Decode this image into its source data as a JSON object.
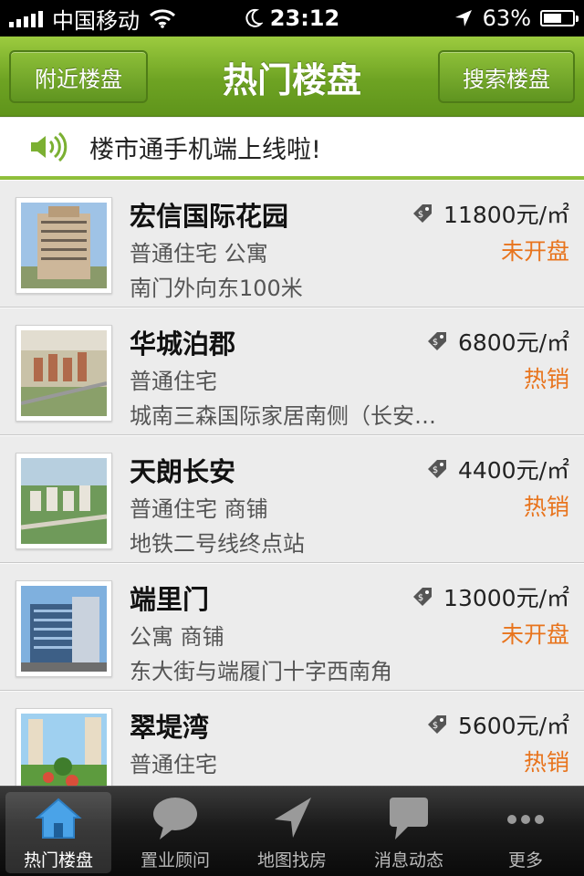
{
  "status_bar": {
    "carrier": "中国移动",
    "time": "23:12",
    "battery_percent": "63%",
    "battery_level": 0.63,
    "icons": [
      "signal-icon",
      "wifi-icon",
      "moon-icon",
      "location-arrow-icon",
      "battery-icon"
    ]
  },
  "nav": {
    "left_button": "附近楼盘",
    "title": "热门楼盘",
    "right_button": "搜索楼盘"
  },
  "notice": {
    "icon": "speaker-icon",
    "text": "楼市通手机端上线啦!"
  },
  "listings": [
    {
      "name": "宏信国际花园",
      "type": "普通住宅 公寓",
      "address": "南门外向东100米",
      "price": "11800元/㎡",
      "status": "未开盘",
      "thumb": "tower"
    },
    {
      "name": "华城泊郡",
      "type": "普通住宅",
      "address": "城南三森国际家居南侧（长安…",
      "price": "6800元/㎡",
      "status": "热销",
      "thumb": "aerial"
    },
    {
      "name": "天朗长安",
      "type": "普通住宅 商铺",
      "address": "地铁二号线终点站",
      "price": "4400元/㎡",
      "status": "热销",
      "thumb": "aerial2"
    },
    {
      "name": "端里门",
      "type": "公寓 商铺",
      "address": "东大街与端履门十字西南角",
      "price": "13000元/㎡",
      "status": "未开盘",
      "thumb": "office"
    },
    {
      "name": "翠堤湾",
      "type": "普通住宅",
      "address": "",
      "price": "5600元/㎡",
      "status": "热销",
      "thumb": "garden"
    }
  ],
  "tabs": [
    {
      "label": "热门楼盘",
      "icon": "house-icon",
      "active": true
    },
    {
      "label": "置业顾问",
      "icon": "chat-bubble-icon",
      "active": false
    },
    {
      "label": "地图找房",
      "icon": "navigation-arrow-icon",
      "active": false
    },
    {
      "label": "消息动态",
      "icon": "message-icon",
      "active": false
    },
    {
      "label": "更多",
      "icon": "more-dots-icon",
      "active": false
    }
  ],
  "colors": {
    "nav_green": "#6ea323",
    "status_orange": "#e8741d",
    "tab_bar": "#1a1a1a"
  }
}
